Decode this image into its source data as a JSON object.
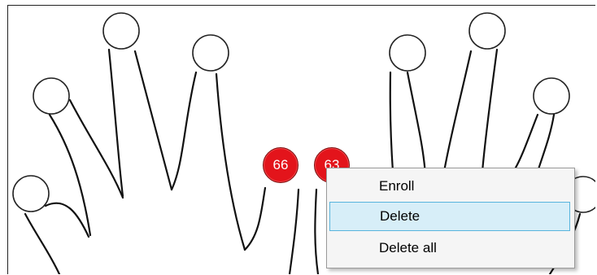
{
  "fingers": {
    "left_index": {
      "badge": "66",
      "color": "#e3141b"
    },
    "right_index": {
      "badge": "63",
      "color": "#e3141b"
    }
  },
  "context_menu": {
    "items": [
      {
        "label": "Enroll",
        "hover": false
      },
      {
        "label": "Delete",
        "hover": true
      },
      {
        "label": "Delete all",
        "hover": false
      }
    ]
  }
}
